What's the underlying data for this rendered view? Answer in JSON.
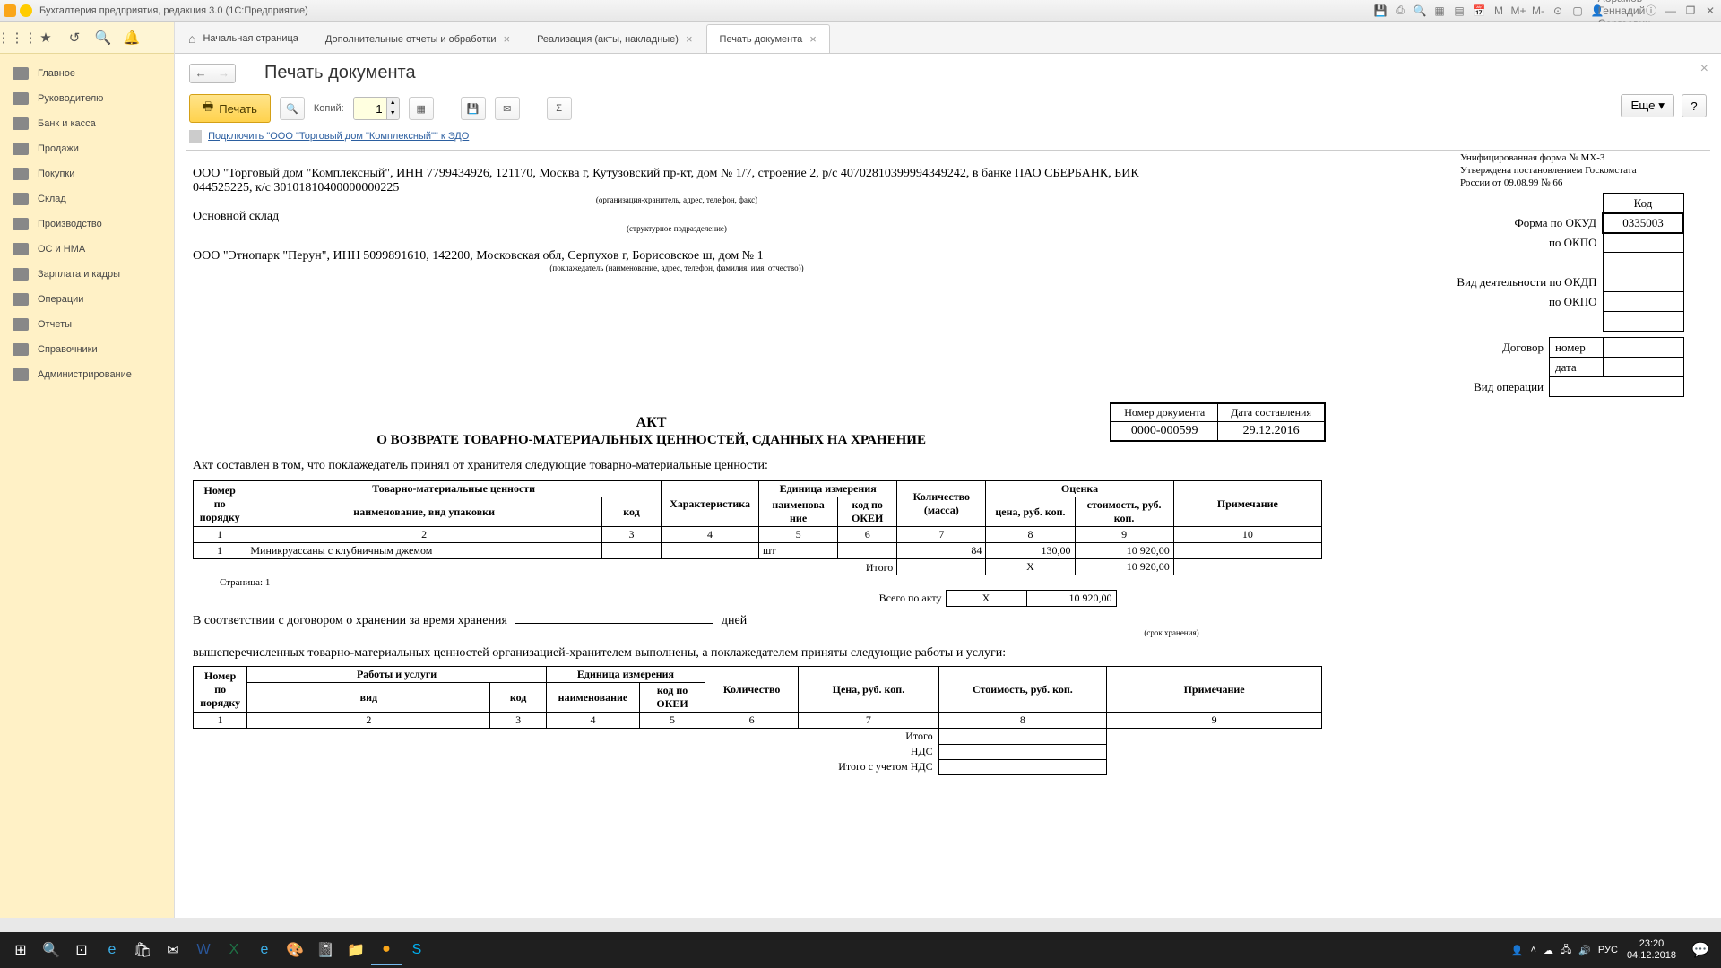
{
  "titlebar": {
    "title": "Бухгалтерия предприятия, редакция 3.0  (1С:Предприятие)",
    "user": "Абрамов Геннадий Сергеевич"
  },
  "sidebar": {
    "items": [
      {
        "label": "Главное"
      },
      {
        "label": "Руководителю"
      },
      {
        "label": "Банк и касса"
      },
      {
        "label": "Продажи"
      },
      {
        "label": "Покупки"
      },
      {
        "label": "Склад"
      },
      {
        "label": "Производство"
      },
      {
        "label": "ОС и НМА"
      },
      {
        "label": "Зарплата и кадры"
      },
      {
        "label": "Операции"
      },
      {
        "label": "Отчеты"
      },
      {
        "label": "Справочники"
      },
      {
        "label": "Администрирование"
      }
    ]
  },
  "tabs": [
    {
      "label": "Начальная страница",
      "home": true,
      "closable": false
    },
    {
      "label": "Дополнительные отчеты и обработки",
      "closable": true
    },
    {
      "label": "Реализация (акты, накладные)",
      "closable": true
    },
    {
      "label": "Печать документа",
      "closable": true,
      "active": true
    }
  ],
  "page": {
    "title": "Печать документа"
  },
  "toolbar": {
    "print": "Печать",
    "copies_label": "Копий:",
    "copies_value": "1",
    "more": "Еще",
    "help": "?"
  },
  "edo": {
    "text": "Подключить \"ООО \"Торговый дом \"Комплексный\"\" к ЭДО"
  },
  "doc": {
    "form_note": "Унифицированная форма № МХ-3\nУтверждена постановлением Госкомстата\nРоссии от 09.08.99 № 66",
    "codes": {
      "hdr": "Код",
      "okud_lbl": "Форма по ОКУД",
      "okud": "0335003",
      "okpo_lbl": "по ОКПО",
      "okdp_lbl": "Вид деятельности по ОКДП",
      "okpo2_lbl": "по ОКПО",
      "contract_lbl": "Договор",
      "number_lbl": "номер",
      "date_lbl": "дата",
      "optype_lbl": "Вид операции"
    },
    "org_line": "ООО \"Торговый дом \"Комплексный\", ИНН 7799434926, 121170, Москва г, Кутузовский пр-кт, дом № 1/7, строение 2, р/с 40702810399994349242, в банке ПАО СБЕРБАНК, БИК 044525225, к/с 30101810400000000225",
    "org_note": "(организация-хранитель, адрес, телефон, факс)",
    "dept": "Основной склад",
    "dept_note": "(структурное подразделение)",
    "depositor": "ООО \"Этнопарк \"Перун\", ИНН 5099891610, 142200, Московская обл, Серпухов г, Борисовское ш, дом № 1",
    "depositor_note": "(поклажедатель (наименование, адрес, телефон, фамилия, имя, отчество))",
    "docnum": {
      "h1": "Номер документа",
      "h2": "Дата составления",
      "num": "0000-000599",
      "date": "29.12.2016"
    },
    "title1": "АКТ",
    "title2": "О ВОЗВРАТЕ ТОВАРНО-МАТЕРИАЛЬНЫХ ЦЕННОСТЕЙ, СДАННЫХ НА ХРАНЕНИЕ",
    "preamble": "Акт составлен в том, что поклажедатель принял от хранителя следующие товарно-материальные ценности:",
    "tbl1": {
      "h_num": "Номер по порядку",
      "h_tmc": "Товарно-материальные ценности",
      "h_name": "наименование, вид упаковки",
      "h_code": "код",
      "h_char": "Характеристика",
      "h_unit": "Единица измерения",
      "h_unit_name": "наименова ние",
      "h_unit_code": "код по ОКЕИ",
      "h_qty": "Количество (масса)",
      "h_val": "Оценка",
      "h_price": "цена, руб. коп.",
      "h_cost": "стоимость, руб. коп.",
      "h_note": "Примечание",
      "cols": [
        "1",
        "2",
        "3",
        "4",
        "5",
        "6",
        "7",
        "8",
        "9",
        "10"
      ],
      "row": {
        "n": "1",
        "name": "Миникруассаны с клубничным джемом",
        "code": "",
        "char": "",
        "unit": "шт",
        "ucode": "",
        "qty": "84",
        "price": "130,00",
        "cost": "10 920,00",
        "note": ""
      },
      "itogo": "Итого",
      "itogo_cost": "10 920,00",
      "x": "X",
      "total": "Всего по акту",
      "total_cost": "10 920,00"
    },
    "pager": "Страница: 1",
    "contract_line": "В соответствии с договором о хранении за время хранения",
    "days": "дней",
    "srok": "(срок хранения)",
    "works_line": "вышеперечисленных товарно-материальных ценностей организацией-хранителем выполнены, а поклажедателем приняты следующие работы и услуги:",
    "tbl2": {
      "h_num": "Номер по порядку",
      "h_work": "Работы и услуги",
      "h_type": "вид",
      "h_code": "код",
      "h_unit": "Единица измерения",
      "h_unit_name": "наименование",
      "h_unit_code": "код по ОКЕИ",
      "h_qty": "Количество",
      "h_price": "Цена, руб. коп.",
      "h_cost": "Стоимость, руб. коп.",
      "h_note": "Примечание",
      "cols": [
        "1",
        "2",
        "3",
        "4",
        "5",
        "6",
        "7",
        "8",
        "9"
      ],
      "itogo": "Итого",
      "nds": "НДС",
      "total_nds": "Итого с учетом НДС"
    }
  },
  "taskbar": {
    "time": "23:20",
    "date": "04.12.2018"
  }
}
